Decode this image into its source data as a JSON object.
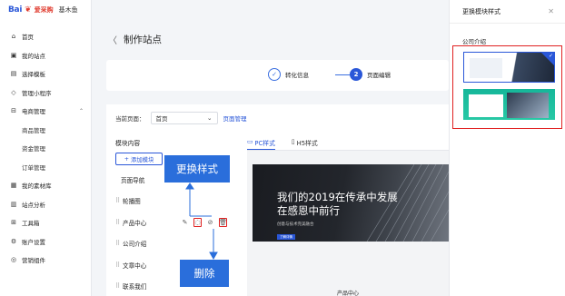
{
  "brand": {
    "logo_text": "Bai",
    "logo_sub": "爱采购",
    "product": "基木鱼"
  },
  "sidebar": {
    "items": [
      {
        "label": "首页",
        "icon": "home-icon",
        "glyph": "⌂"
      },
      {
        "label": "我的站点",
        "icon": "site-icon",
        "glyph": "▣"
      },
      {
        "label": "选择模板",
        "icon": "template-icon",
        "glyph": "▤"
      },
      {
        "label": "管理小程序",
        "icon": "miniprogram-icon",
        "glyph": "◇"
      },
      {
        "label": "电商管理",
        "icon": "cart-icon",
        "glyph": "⊟"
      },
      {
        "label": "商品管理",
        "icon": "",
        "glyph": ""
      },
      {
        "label": "资金管理",
        "icon": "",
        "glyph": ""
      },
      {
        "label": "订单管理",
        "icon": "",
        "glyph": ""
      },
      {
        "label": "我的素材库",
        "icon": "library-icon",
        "glyph": "▦"
      },
      {
        "label": "站点分析",
        "icon": "analytics-icon",
        "glyph": "▥"
      },
      {
        "label": "工具箱",
        "icon": "toolbox-icon",
        "glyph": "⊞"
      },
      {
        "label": "账户设置",
        "icon": "settings-icon",
        "glyph": "⚙"
      },
      {
        "label": "营销组件",
        "icon": "marketing-icon",
        "glyph": "◎"
      }
    ]
  },
  "header": {
    "back_icon": "back-arrow-icon",
    "title": "制作站点"
  },
  "steps": [
    {
      "label": "转化信息",
      "state": "done",
      "mark": "✓"
    },
    {
      "label": "页面编辑",
      "state": "active",
      "mark": "2"
    }
  ],
  "toolbar": {
    "current_page_label": "当前页面：",
    "current_page_value": "首页",
    "manage_link": "页面管理"
  },
  "modules": {
    "title": "模块内容",
    "add_button": "添加模块",
    "items": [
      "页面导航",
      "轮播图",
      "产品中心",
      "公司介绍",
      "文章中心",
      "联系我们"
    ]
  },
  "tabs": [
    {
      "label": "PC样式",
      "active": true
    },
    {
      "label": "H5样式",
      "active": false
    }
  ],
  "preview": {
    "banner_title_line1": "我们的2019在传承中发展",
    "banner_title_line2": "在感恩中前行",
    "banner_subtitle": "创意与技术完美融合",
    "banner_button": "了解详情",
    "section_label": "产品中心"
  },
  "callouts": {
    "change_style": "更换样式",
    "delete": "删除"
  },
  "panel": {
    "title": "更换模块样式",
    "close_icon": "close-icon",
    "section_title": "公司介绍"
  },
  "colors": {
    "primary": "#2a57d8",
    "callout": "#2a6edb",
    "highlight": "#e02020"
  }
}
